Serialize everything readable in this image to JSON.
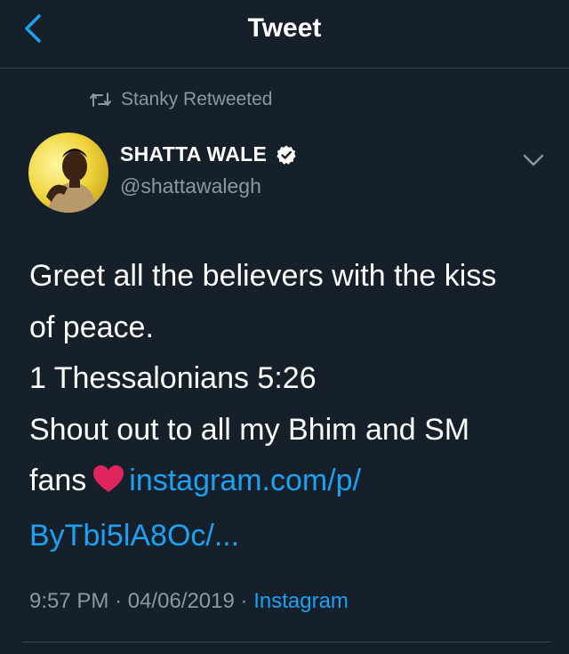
{
  "header": {
    "title": "Tweet",
    "back_icon": "chevron-left-icon"
  },
  "retweet": {
    "icon": "retweet-icon",
    "text": "Stanky Retweeted"
  },
  "author": {
    "display_name": "SHATTA WALE",
    "handle": "@shattawalegh",
    "verified": true
  },
  "tweet": {
    "line1": "Greet all the believers with the kiss",
    "line2": "of peace.",
    "line3": "1 Thessalonians 5:26",
    "line4": "Shout out to all my Bhim and SM",
    "line5_text": "fans",
    "emoji": "heart-emoji",
    "link_part1": "instagram.com/p/",
    "link_part2": "ByTbi5lA8Oc/..."
  },
  "meta": {
    "time": "9:57 PM",
    "separator": "·",
    "date": "04/06/2019",
    "source": "Instagram"
  },
  "colors": {
    "background": "#15202b",
    "accent": "#1da1f2",
    "secondary_text": "#8899a6",
    "divider": "#38444d",
    "heart": "#e0245e"
  }
}
